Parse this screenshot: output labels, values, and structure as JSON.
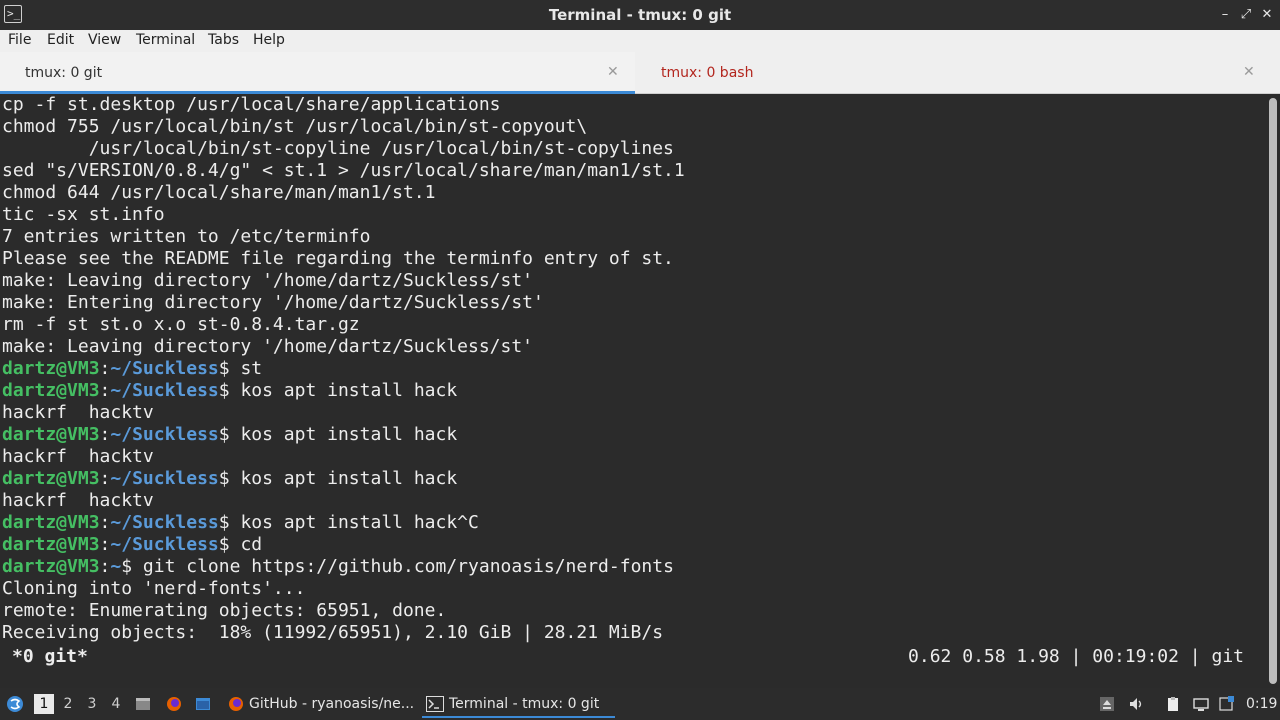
{
  "window": {
    "title": "Terminal - tmux: 0 git",
    "app_icon_glyph": ">_",
    "minimize_glyph": "–",
    "maximize_glyph": "⤢",
    "close_glyph": "✕"
  },
  "menu": {
    "items": [
      "File",
      "Edit",
      "View",
      "Terminal",
      "Tabs",
      "Help"
    ]
  },
  "tabs": [
    {
      "label": "tmux: 0 git",
      "active": true,
      "close": "✕"
    },
    {
      "label": "tmux: 0 bash",
      "active": false,
      "close": "✕"
    }
  ],
  "terminal": {
    "lines": [
      "cp -f st.desktop /usr/local/share/applications",
      "chmod 755 /usr/local/bin/st /usr/local/bin/st-copyout\\",
      "        /usr/local/bin/st-copyline /usr/local/bin/st-copylines",
      "sed \"s/VERSION/0.8.4/g\" < st.1 > /usr/local/share/man/man1/st.1",
      "chmod 644 /usr/local/share/man/man1/st.1",
      "tic -sx st.info",
      "7 entries written to /etc/terminfo",
      "Please see the README file regarding the terminfo entry of st.",
      "make: Leaving directory '/home/dartz/Suckless/st'",
      "make: Entering directory '/home/dartz/Suckless/st'",
      "rm -f st st.o x.o st-0.8.4.tar.gz",
      "make: Leaving directory '/home/dartz/Suckless/st'"
    ],
    "prompt_user": "dartz@VM3",
    "prompt_sep": ":",
    "prompts": [
      {
        "path": "~/Suckless",
        "cmd": "$ st"
      },
      {
        "path": "~/Suckless",
        "cmd": "$ kos apt install hack"
      },
      {
        "output": "hackrf  hacktv"
      },
      {
        "path": "~/Suckless",
        "cmd": "$ kos apt install hack"
      },
      {
        "output": "hackrf  hacktv"
      },
      {
        "path": "~/Suckless",
        "cmd": "$ kos apt install hack"
      },
      {
        "output": "hackrf  hacktv"
      },
      {
        "path": "~/Suckless",
        "cmd": "$ kos apt install hack^C"
      },
      {
        "path": "~/Suckless",
        "cmd": "$ cd"
      },
      {
        "path": "~",
        "cmd": "$ git clone https://github.com/ryanoasis/nerd-fonts"
      },
      {
        "output": "Cloning into 'nerd-fonts'..."
      },
      {
        "output": "remote: Enumerating objects: 65951, done."
      },
      {
        "output": "Receiving objects:  18% (11992/65951), 2.10 GiB | 28.21 MiB/s"
      }
    ],
    "status_left": "*0 git*",
    "status_right": "0.62 0.58 1.98 | 00:19:02 | git"
  },
  "taskbar": {
    "workspaces": [
      "1",
      "2",
      "3",
      "4"
    ],
    "active_workspace": "1",
    "tasks": [
      {
        "label": "GitHub - ryanoasis/ne...",
        "icon": "firefox-icon"
      },
      {
        "label": "Terminal - tmux: 0 git",
        "icon": "terminal-icon"
      }
    ],
    "clock": "0:19",
    "colors": {
      "accent": "#3c8ad6",
      "prompt_user": "#45bf63",
      "prompt_path": "#5a9ad9"
    }
  }
}
